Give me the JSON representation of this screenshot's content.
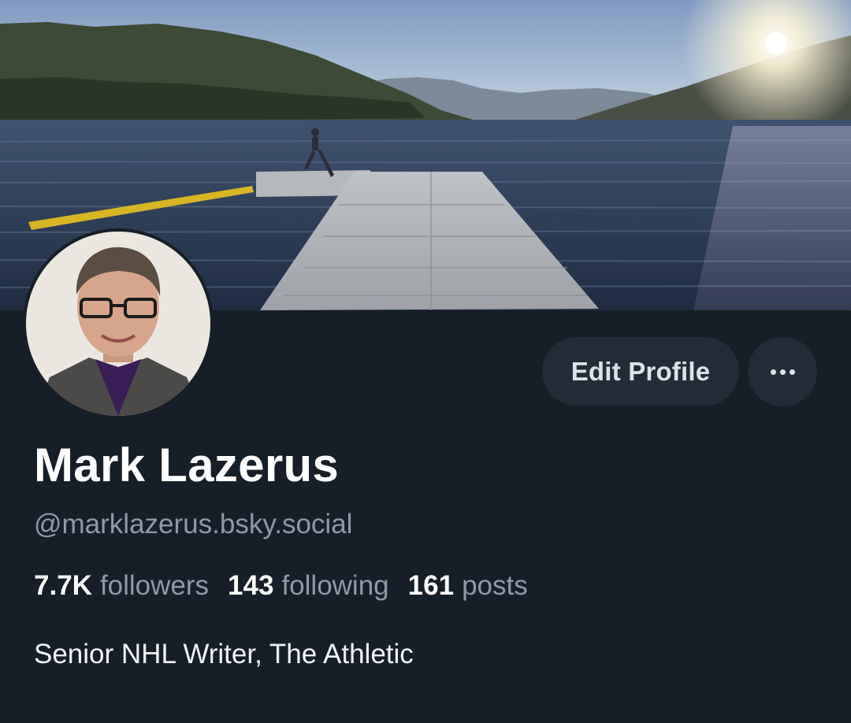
{
  "profile": {
    "display_name": "Mark Lazerus",
    "handle": "@marklazerus.bsky.social",
    "bio": "Senior NHL Writer, The Athletic",
    "stats": {
      "followers_count": "7.7K",
      "followers_label": "followers",
      "following_count": "143",
      "following_label": "following",
      "posts_count": "161",
      "posts_label": "posts"
    }
  },
  "actions": {
    "edit_label": "Edit Profile",
    "more_icon": "ellipsis-icon"
  },
  "banner": {
    "description_icon": "lake-dock-photo"
  },
  "colors": {
    "background": "#161e27",
    "button_bg": "#222c37",
    "muted_text": "#8d9aa9",
    "primary_text": "#ffffff"
  }
}
